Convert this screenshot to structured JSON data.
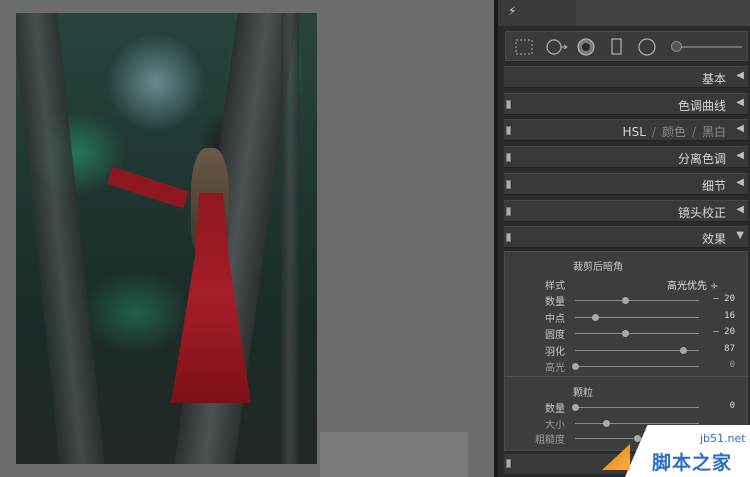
{
  "panel": {
    "topbar": {
      "icon": "lightning-icon"
    },
    "tools": [
      "crop-overlay-icon",
      "spot-removal-icon",
      "red-eye-icon",
      "graduated-filter-icon",
      "radial-filter-icon",
      "adjustment-brush-icon"
    ],
    "sections": [
      {
        "title": "基本",
        "state": "collapsed"
      },
      {
        "title": "色调曲线",
        "state": "collapsed"
      },
      {
        "title": "HSL",
        "extra": [
          "颜色",
          "黑白"
        ],
        "state": "collapsed"
      },
      {
        "title": "分离色调",
        "state": "collapsed"
      },
      {
        "title": "细节",
        "state": "collapsed"
      },
      {
        "title": "镜头校正",
        "state": "collapsed"
      },
      {
        "title": "效果",
        "state": "expanded"
      }
    ],
    "effects": {
      "vignette": {
        "header": "裁剪后暗角",
        "style_label": "样式",
        "style_value": "高光优先 ÷",
        "sliders": [
          {
            "label": "数量",
            "value": "– 20",
            "fraction": 0.4
          },
          {
            "label": "中点",
            "value": "16",
            "fraction": 0.16
          },
          {
            "label": "圆度",
            "value": "– 20",
            "fraction": 0.4
          },
          {
            "label": "羽化",
            "value": "87",
            "fraction": 0.87
          },
          {
            "label": "高光",
            "value": "0",
            "fraction": 0.0,
            "dimmed": true
          }
        ]
      },
      "grain": {
        "header": "颗粒",
        "sliders": [
          {
            "label": "数量",
            "value": "0",
            "fraction": 0.0
          },
          {
            "label": "大小",
            "value": "",
            "fraction": 0.25,
            "dimmed": true
          },
          {
            "label": "粗糙度",
            "value": "",
            "fraction": 0.5,
            "dimmed": true
          }
        ]
      }
    }
  },
  "watermark": {
    "url": "jb51.net",
    "name": "脚本之家"
  },
  "colors": {
    "panel_bg": "#2a2a2a",
    "section_bg": "#393939",
    "canvas_bg": "#6c6c6c",
    "watermark_blue": "#2b6fc4"
  }
}
